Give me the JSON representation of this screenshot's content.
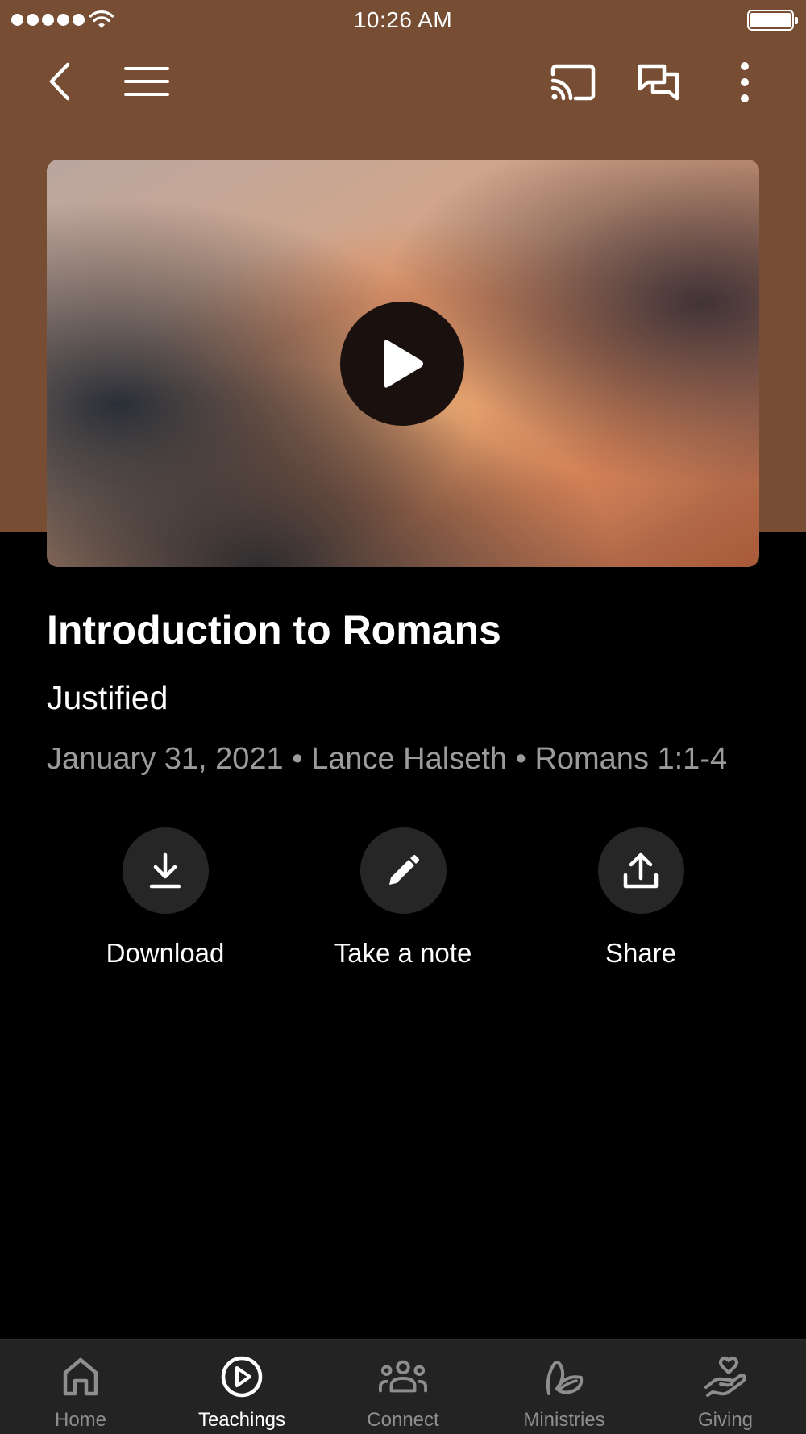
{
  "status_bar": {
    "time": "10:26 AM"
  },
  "toolbar": {
    "back_icon": "chevron-left-icon",
    "menu_icon": "hamburger-menu-icon",
    "cast_icon": "cast-icon",
    "chat_icon": "chat-bubbles-icon",
    "more_icon": "more-vertical-icon"
  },
  "colors": {
    "header": "#774e33",
    "background": "#000000",
    "action_circle": "#262626",
    "tabbar": "#232323",
    "inactive": "#8e8e8e"
  },
  "video": {
    "play_icon": "play-icon"
  },
  "teaching": {
    "title": "Introduction to Romans",
    "series": "Justified",
    "meta": "January 31, 2021 • Lance Halseth • Romans 1:1-4"
  },
  "actions": [
    {
      "label": "Download",
      "icon": "download-icon"
    },
    {
      "label": "Take a note",
      "icon": "pencil-icon"
    },
    {
      "label": "Share",
      "icon": "share-upload-icon"
    }
  ],
  "tabs": [
    {
      "label": "Home",
      "icon": "home-icon",
      "active": false
    },
    {
      "label": "Teachings",
      "icon": "play-circle-icon",
      "active": true
    },
    {
      "label": "Connect",
      "icon": "people-icon",
      "active": false
    },
    {
      "label": "Ministries",
      "icon": "leaf-icon",
      "active": false
    },
    {
      "label": "Giving",
      "icon": "hand-heart-icon",
      "active": false
    }
  ]
}
